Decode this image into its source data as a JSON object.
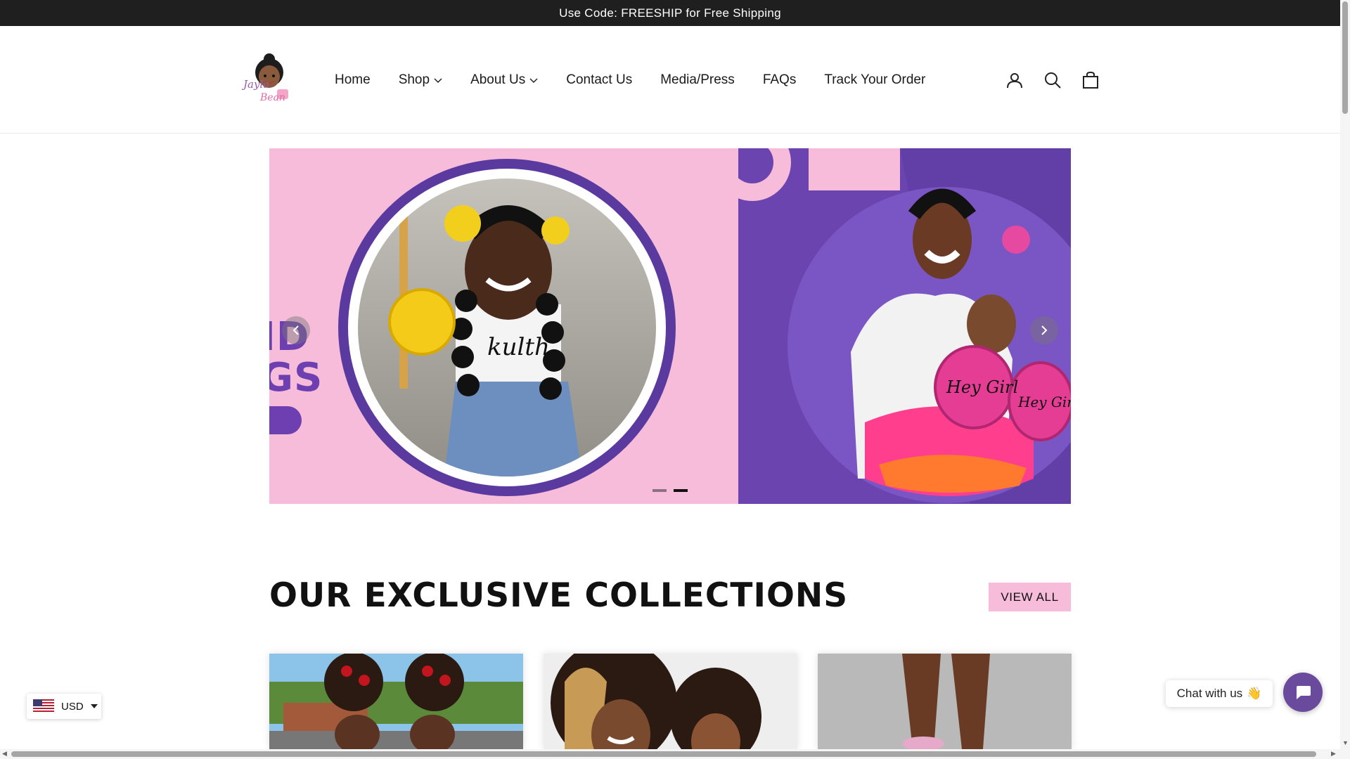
{
  "announcement": {
    "text": "Use Code: FREESHIP for Free Shipping"
  },
  "header": {
    "logo_alt": "Jayla & Bean",
    "nav": [
      {
        "label": "Home",
        "dropdown": false,
        "icon": ""
      },
      {
        "label": "Shop",
        "dropdown": true,
        "icon": "chevron-down-icon"
      },
      {
        "label": "About Us",
        "dropdown": true,
        "icon": "chevron-down-icon"
      },
      {
        "label": "Contact Us",
        "dropdown": false,
        "icon": ""
      },
      {
        "label": "Media/Press",
        "dropdown": false,
        "icon": ""
      },
      {
        "label": "FAQs",
        "dropdown": false,
        "icon": ""
      },
      {
        "label": "Track Your Order",
        "dropdown": false,
        "icon": ""
      }
    ],
    "icons": [
      "account-icon",
      "search-icon",
      "cart-icon"
    ]
  },
  "hero": {
    "text_line1": "ID",
    "text_line2": "GS",
    "prev_icon": "chevron-left-icon",
    "next_icon": "chevron-right-icon",
    "slide_count": 2,
    "active_slide": 2,
    "bag_text": "Hey Girl",
    "shirt_text": "kulth",
    "colors": {
      "pink": "#f6bcd9",
      "purple": "#6b44b0",
      "accent": "#5b3aa0"
    }
  },
  "collections": {
    "title": "OUR EXCLUSIVE COLLECTIONS",
    "view_all": "VIEW ALL"
  },
  "currency": {
    "code": "USD",
    "flag_icon": "us-flag-icon"
  },
  "chat": {
    "label": "Chat with us",
    "emoji": "👋",
    "icon": "chat-bubble-icon"
  }
}
